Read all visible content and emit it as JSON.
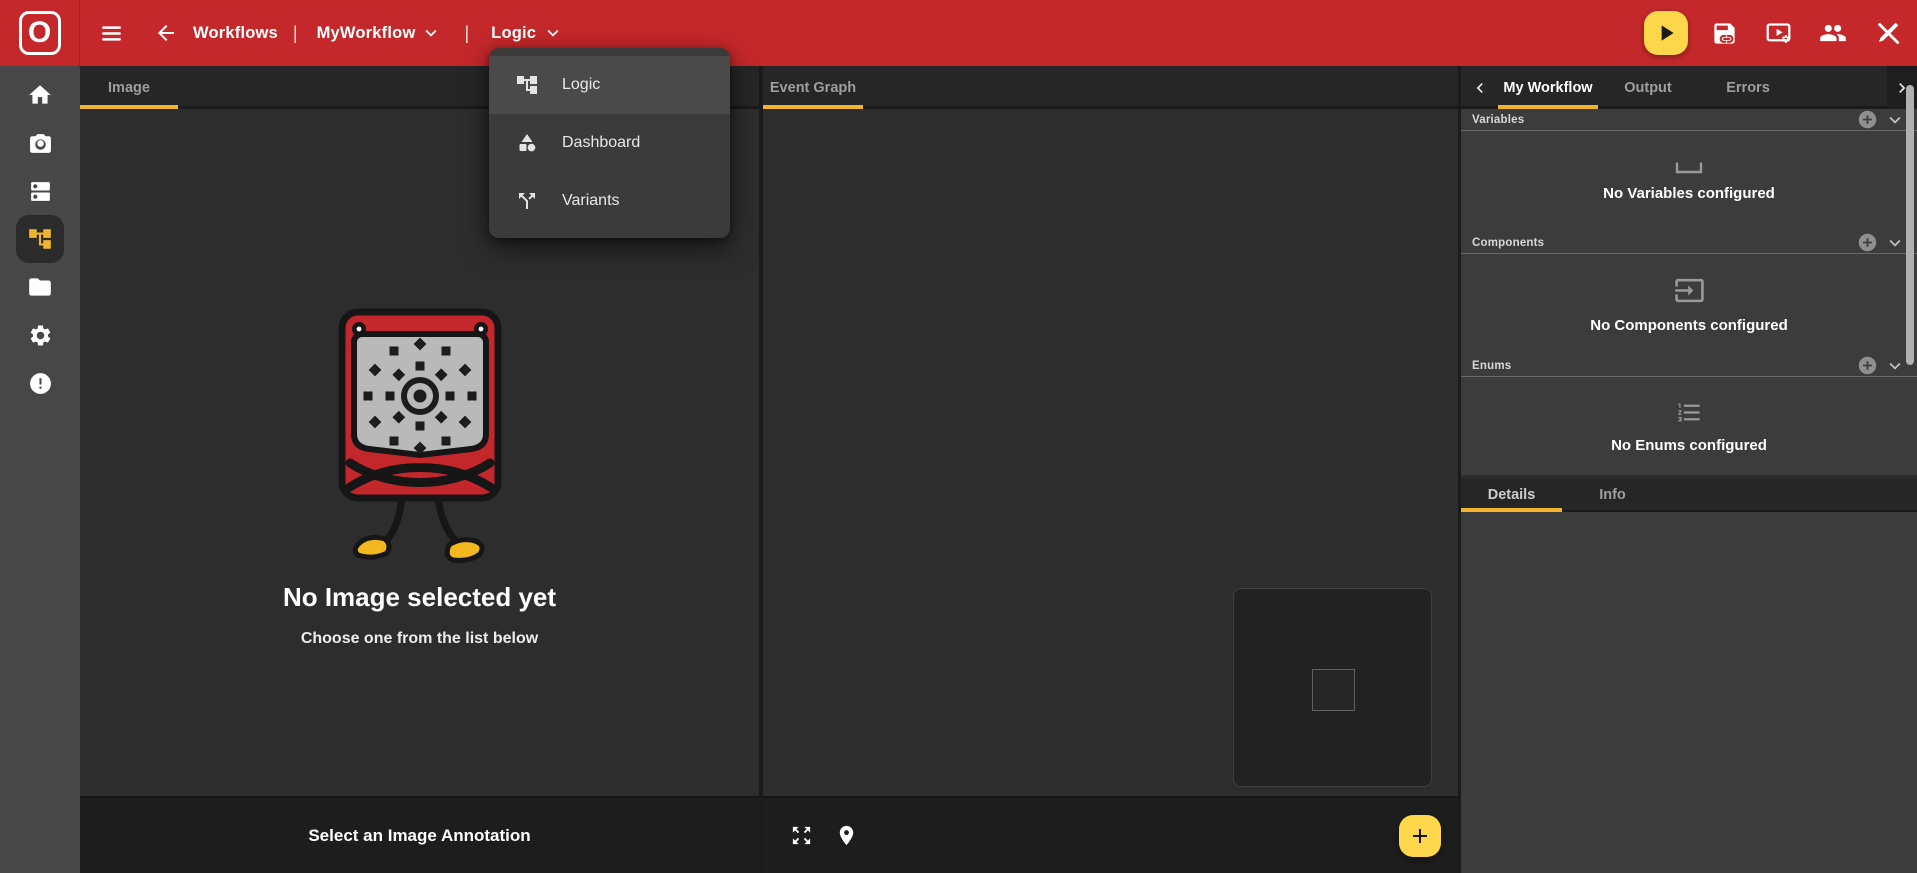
{
  "header": {
    "logo_text": "O",
    "back_label": "Workflows",
    "workflow_name": "MyWorkflow",
    "view_name": "Logic",
    "separator": "|",
    "action_icons": [
      "run",
      "save-link",
      "playback-settings",
      "collaborators",
      "close-editor"
    ],
    "colors": {
      "bar_red": "#c4282b",
      "run_yellow": "#fdd64a"
    }
  },
  "sidebar": {
    "items": [
      {
        "icon": "home",
        "active": false
      },
      {
        "icon": "camera",
        "active": false
      },
      {
        "icon": "dataset-list",
        "active": false
      },
      {
        "icon": "workflow",
        "active": true
      },
      {
        "icon": "folder",
        "active": false
      },
      {
        "icon": "settings",
        "active": false
      },
      {
        "icon": "alerts",
        "active": false
      }
    ],
    "active_color": "#f0b42d"
  },
  "menu": {
    "items": [
      {
        "label": "Logic",
        "icon": "workflow-tree",
        "active": true
      },
      {
        "label": "Dashboard",
        "icon": "shapes",
        "active": false
      },
      {
        "label": "Variants",
        "icon": "split",
        "active": false
      }
    ]
  },
  "image_panel": {
    "tab_label": "Image",
    "empty_title": "No Image selected yet",
    "empty_subtitle": "Choose one from the list below",
    "footer_label": "Select an Image Annotation"
  },
  "event_panel": {
    "tab_label": "Event Graph",
    "footer_icons": [
      "fit-view",
      "locate"
    ],
    "fab_icon": "plus"
  },
  "right_panel": {
    "tabs": [
      {
        "label": "My Workflow",
        "active": true
      },
      {
        "label": "Output",
        "active": false
      },
      {
        "label": "Errors",
        "active": false
      }
    ],
    "sections": [
      {
        "title": "Variables",
        "empty_text": "No Variables configured",
        "icon": "bracket"
      },
      {
        "title": "Components",
        "empty_text": "No Components configured",
        "icon": "input"
      },
      {
        "title": "Enums",
        "empty_text": "No Enums configured",
        "icon": "numbered-list"
      }
    ],
    "detail_tabs": [
      {
        "label": "Details",
        "active": true
      },
      {
        "label": "Info",
        "active": false
      }
    ],
    "accent": "#f0b42d"
  }
}
